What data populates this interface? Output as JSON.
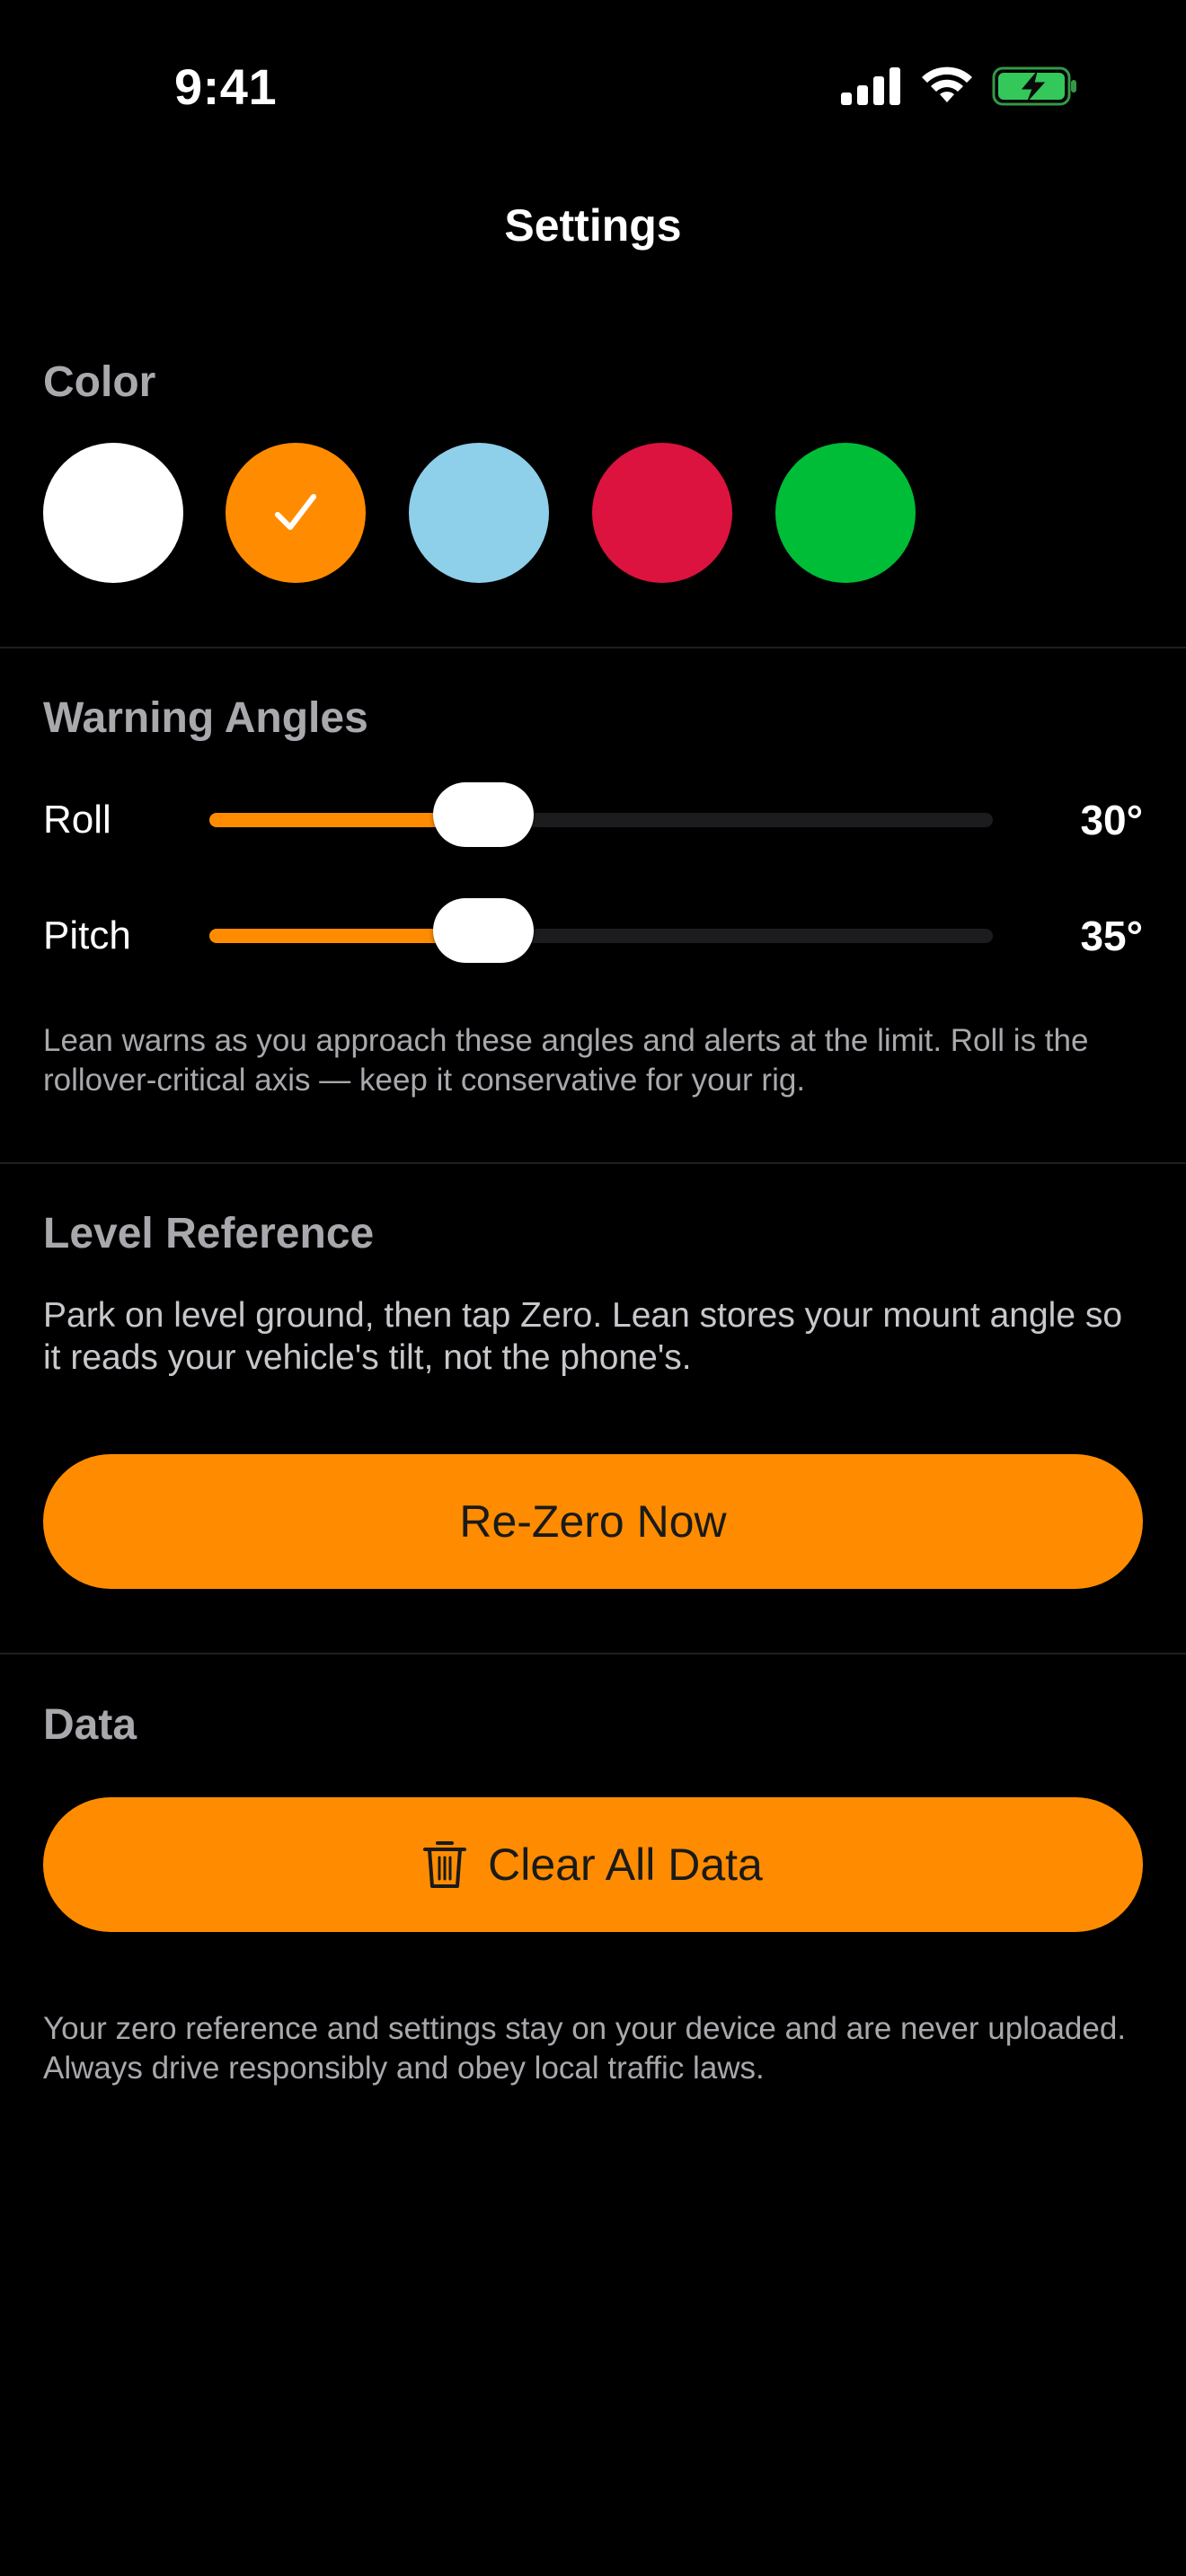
{
  "status_bar": {
    "time": "9:41"
  },
  "nav": {
    "title": "Settings"
  },
  "colors": {
    "section_title": "Color",
    "swatches": [
      {
        "name": "white",
        "hex": "#ffffff",
        "selected": false
      },
      {
        "name": "orange",
        "hex": "#ff8c00",
        "selected": true
      },
      {
        "name": "light-blue",
        "hex": "#8ecfea",
        "selected": false
      },
      {
        "name": "red",
        "hex": "#dc133f",
        "selected": false
      },
      {
        "name": "green",
        "hex": "#00bd37",
        "selected": false
      }
    ],
    "selected_icon": "checkmark-icon"
  },
  "warning_angles": {
    "section_title": "Warning Angles",
    "roll": {
      "label": "Roll",
      "value_text": "30°",
      "fill_fraction": 0.35
    },
    "pitch": {
      "label": "Pitch",
      "value_text": "35°",
      "fill_fraction": 0.35
    },
    "caption": "Lean warns as you approach these angles and alerts at the limit. Roll is the rollover-critical axis — keep it conservative for your rig."
  },
  "level_reference": {
    "section_title": "Level Reference",
    "description": "Park on level ground, then tap Zero. Lean stores your mount angle so it reads your vehicle's tilt, not the phone's.",
    "button_label": "Re-Zero Now"
  },
  "data_section": {
    "section_title": "Data",
    "button_label": "Clear All Data",
    "button_icon": "trash-icon",
    "footer": "Your zero reference and settings stay on your device and are never uploaded. Always drive responsibly and obey local traffic laws."
  },
  "accent_color": "#ff8c00"
}
